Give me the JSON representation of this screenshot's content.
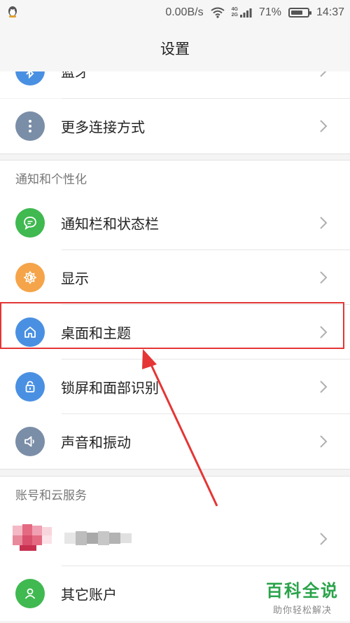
{
  "status_bar": {
    "net_speed": "0.00B/s",
    "net_tag_top": "4G",
    "net_tag_bottom": "2G",
    "battery_text": "71%",
    "battery_level": 0.71,
    "time": "14:37"
  },
  "title": "设置",
  "rows": [
    {
      "label": "蓝牙",
      "icon": "bluetooth-icon",
      "color": "#4a90e2"
    },
    {
      "label": "更多连接方式",
      "icon": "more-icon",
      "color": "#7b8ea8"
    }
  ],
  "section_notify": {
    "header": "通知和个性化",
    "items": [
      {
        "label": "通知栏和状态栏",
        "icon": "chat-bubble-icon",
        "color": "#3fb950"
      },
      {
        "label": "显示",
        "icon": "brightness-icon",
        "color": "#f5a44a"
      },
      {
        "label": "桌面和主题",
        "icon": "home-icon",
        "color": "#4a90e2"
      },
      {
        "label": "锁屏和面部识别",
        "icon": "lock-icon",
        "color": "#4a90e2"
      },
      {
        "label": "声音和振动",
        "icon": "speaker-icon",
        "color": "#7b8ea8"
      }
    ]
  },
  "section_account": {
    "header": "账号和云服务",
    "items": [
      {
        "label": "",
        "icon": "avatar",
        "color": "#e0607a"
      },
      {
        "label": "其它账户",
        "icon": "person-icon",
        "color": "#3fb950"
      }
    ]
  },
  "watermark": {
    "title": "百科全说",
    "subtitle": "助你轻松解决"
  },
  "colors": {
    "highlight": "#e53535",
    "accent_green": "#2aa34a"
  }
}
